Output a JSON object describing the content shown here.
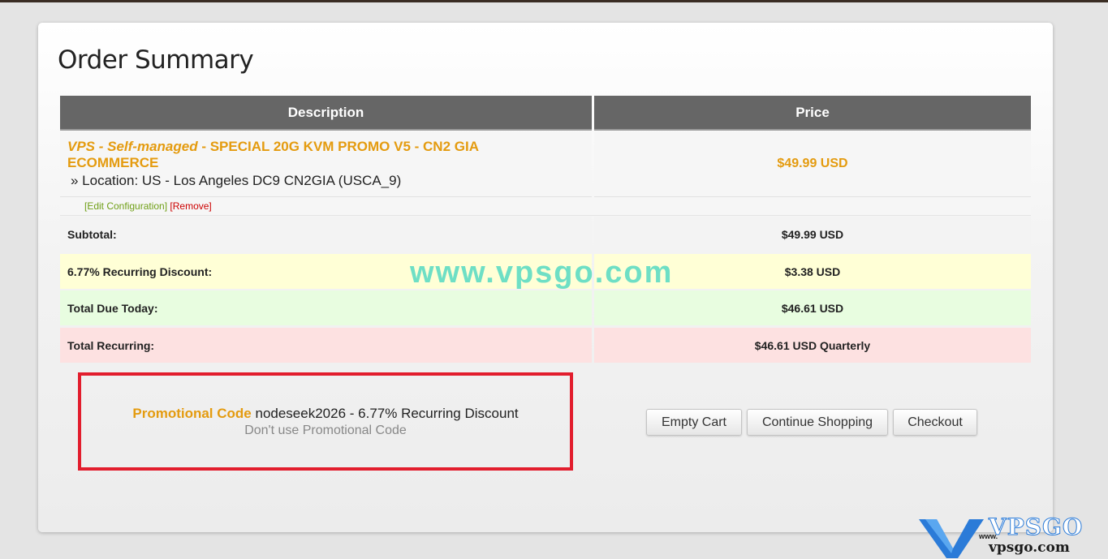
{
  "page": {
    "title": "Order Summary"
  },
  "table": {
    "headers": {
      "description": "Description",
      "price": "Price"
    },
    "product": {
      "group": "VPS - Self-managed",
      "separator": " - ",
      "name": "SPECIAL 20G KVM PROMO V5 - CN2 GIA ECOMMERCE",
      "location": "» Location: US - Los Angeles DC9 CN2GIA (USCA_9)",
      "price": "$49.99 USD",
      "edit_label": "[Edit Configuration]",
      "remove_label": "[Remove]"
    },
    "summary": {
      "subtotal_label": "Subtotal:",
      "subtotal_value": "$49.99 USD",
      "discount_label": "6.77% Recurring Discount:",
      "discount_value": "$3.38 USD",
      "due_label": "Total Due Today:",
      "due_value": "$46.61 USD",
      "recurring_label": "Total Recurring:",
      "recurring_value": "$46.61 USD Quarterly"
    }
  },
  "watermark": "www.vpsgo.com",
  "promo": {
    "label": "Promotional Code",
    "detail": " nodeseek2026 - 6.77% Recurring Discount",
    "remove_label": "Don't use Promotional Code"
  },
  "buttons": {
    "empty_cart": "Empty Cart",
    "continue_shopping": "Continue Shopping",
    "checkout": "Checkout"
  },
  "logo": {
    "brand": "VPSGO",
    "www": "www.",
    "url": "vpsgo.com"
  },
  "colors": {
    "accent_orange": "#e49b0f",
    "header_gray": "#666666",
    "discount_bg": "#ffffd6",
    "due_bg": "#e8fde0",
    "recurring_bg": "#fde1e1",
    "highlight_box": "#e21d2d",
    "watermark": "#5fdcc4"
  }
}
